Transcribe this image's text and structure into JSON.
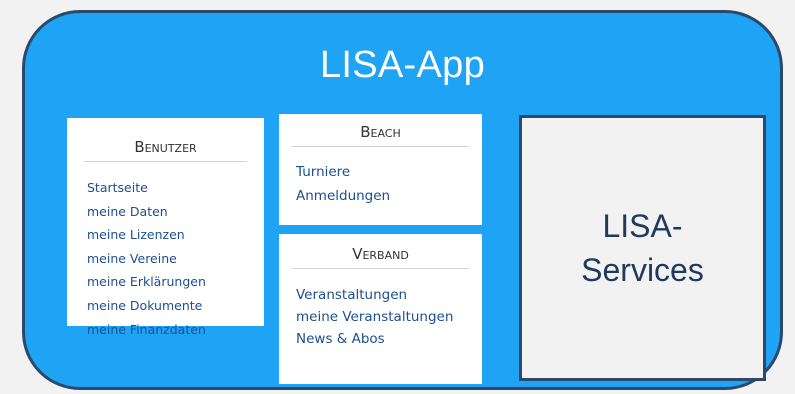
{
  "app": {
    "title": "LISA-App"
  },
  "benutzer": {
    "heading": "Benutzer",
    "items": [
      "Startseite",
      "meine Daten",
      "meine Lizenzen",
      "meine Vereine",
      "meine Erklärungen",
      "meine Dokumente",
      "meine Finanzdaten"
    ]
  },
  "beach": {
    "heading": "Beach",
    "items": [
      "Turniere",
      "Anmeldungen"
    ]
  },
  "verband": {
    "heading": "Verband",
    "items": [
      "Veranstaltungen",
      "meine Veranstaltungen",
      "News & Abos"
    ]
  },
  "services": {
    "label": "LISA-Services"
  },
  "colors": {
    "app_fill": "#1fa3f5",
    "app_border": "#2b4a6b",
    "link": "#1d4f8f",
    "services_fill": "#f2f2f2"
  }
}
